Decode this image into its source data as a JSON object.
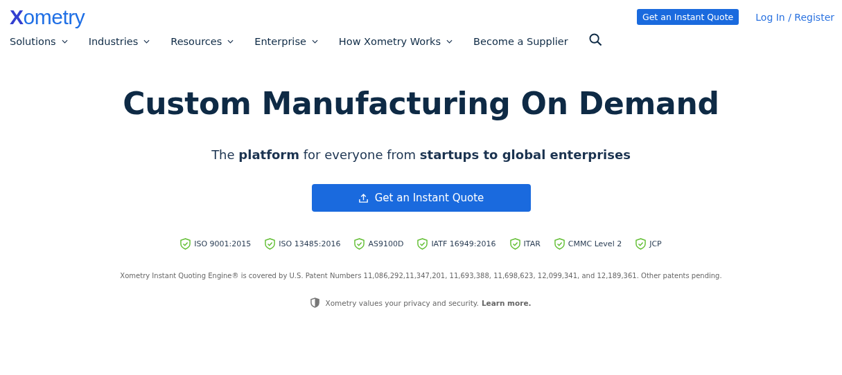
{
  "header": {
    "logo": "Xometry",
    "quote_button": "Get an Instant Quote",
    "login_link": "Log In / Register"
  },
  "nav": [
    {
      "label": "Solutions",
      "dropdown": true
    },
    {
      "label": "Industries",
      "dropdown": true
    },
    {
      "label": "Resources",
      "dropdown": true
    },
    {
      "label": "Enterprise",
      "dropdown": true
    },
    {
      "label": "How Xometry Works",
      "dropdown": true
    },
    {
      "label": "Become a Supplier",
      "dropdown": false
    }
  ],
  "hero": {
    "title": "Custom Manufacturing On Demand",
    "subtitle": "The **platform** for everyone from **startups to global enterprises**",
    "cta": "Get an Instant Quote"
  },
  "certifications": [
    "ISO 9001:2015",
    "ISO 13485:2016",
    "AS9100D",
    "IATF 16949:2016",
    "ITAR",
    "CMMC Level 2",
    "JCP"
  ],
  "patent_notice": "Xometry Instant Quoting Engine® is covered by U.S. Patent Numbers 11,086,292,11,347,201, 11,693,388, 11,698,623, 12,099,341, and 12,189,361. Other patents pending.",
  "privacy": {
    "text": "Xometry values your privacy and security.",
    "link": "Learn more."
  }
}
